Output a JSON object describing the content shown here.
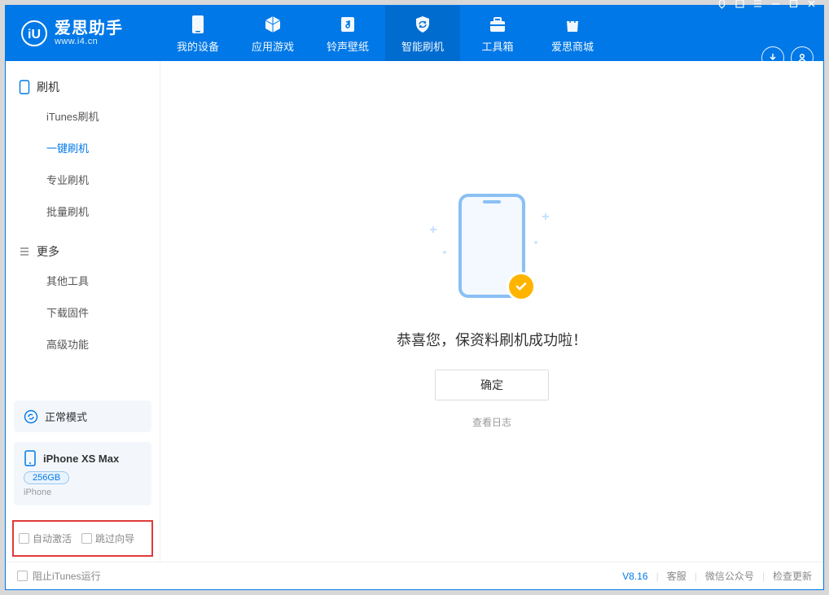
{
  "app": {
    "name": "爱思助手",
    "domain": "www.i4.cn"
  },
  "tabs": {
    "my_device": "我的设备",
    "apps_games": "应用游戏",
    "ring_wall": "铃声壁纸",
    "smart_flash": "智能刷机",
    "toolbox": "工具箱",
    "store": "爱思商城"
  },
  "sidebar": {
    "flash_header": "刷机",
    "items": [
      "iTunes刷机",
      "一键刷机",
      "专业刷机",
      "批量刷机"
    ],
    "more_header": "更多",
    "more_items": [
      "其他工具",
      "下载固件",
      "高级功能"
    ],
    "mode_label": "正常模式",
    "device": {
      "name": "iPhone XS Max",
      "capacity": "256GB",
      "type": "iPhone"
    },
    "opt_auto_activate": "自动激活",
    "opt_skip_guide": "跳过向导"
  },
  "main": {
    "success_text": "恭喜您，保资料刷机成功啦！",
    "ok_label": "确定",
    "view_log": "查看日志"
  },
  "status": {
    "block_itunes": "阻止iTunes运行",
    "version": "V8.16",
    "support": "客服",
    "wechat": "微信公众号",
    "check_update": "检查更新"
  }
}
